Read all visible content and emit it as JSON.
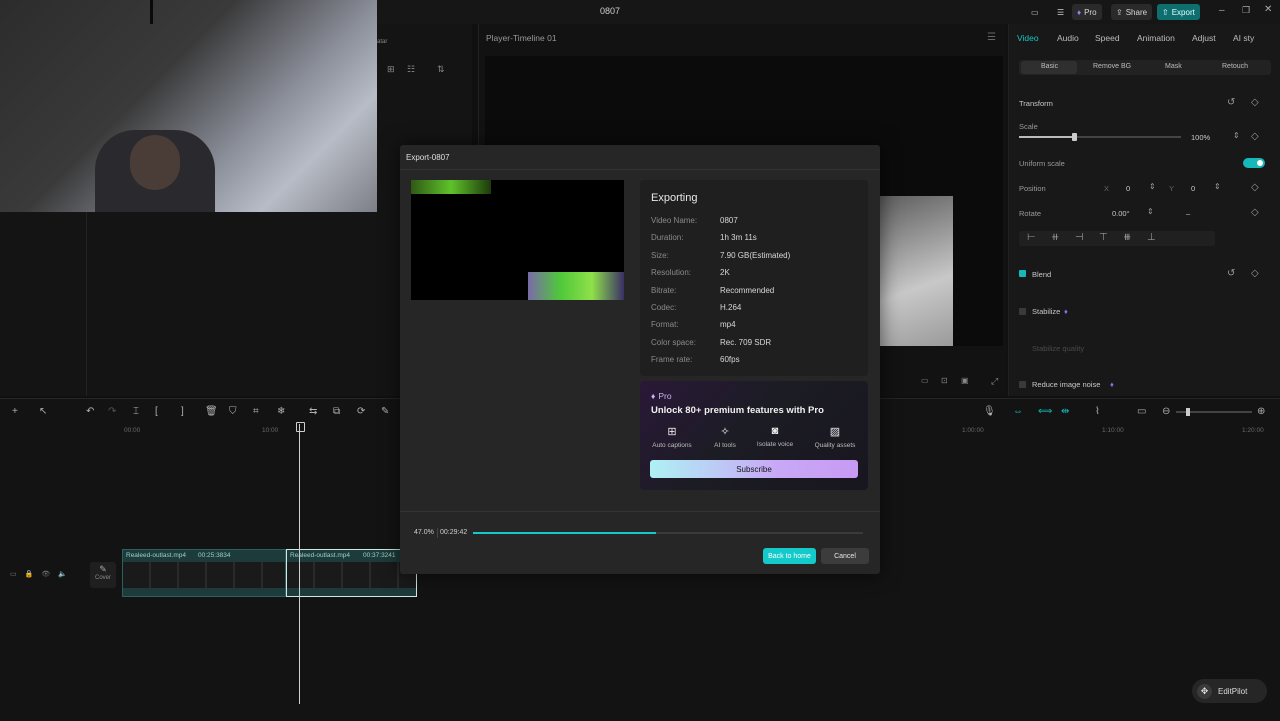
{
  "topbar": {
    "title": "0807",
    "pro_label": "Pro",
    "share_label": "Share",
    "export_label": "Export"
  },
  "player": {
    "title": "Player-Timeline 01"
  },
  "left_panel": {
    "avatar_label": "atar"
  },
  "props": {
    "tabs": [
      "Video",
      "Audio",
      "Speed",
      "Animation",
      "Adjust",
      "AI sty"
    ],
    "subtabs": [
      "Basic",
      "Remove BG",
      "Mask",
      "Retouch"
    ],
    "transform_label": "Transform",
    "scale_label": "Scale",
    "scale_value": "100%",
    "scale_level": 0.34,
    "uniform_scale_label": "Uniform scale",
    "position_label": "Position",
    "pos_x_label": "X",
    "pos_x": "0",
    "pos_y_label": "Y",
    "pos_y": "0",
    "rotate_label": "Rotate",
    "rotate_value": "0.00°",
    "rotate_dash": "–",
    "blend_label": "Blend",
    "stabilize_label": "Stabilize",
    "stabilize_sub": "Stabilize quality",
    "noise_label": "Reduce image noise"
  },
  "modal": {
    "title": "Export-0807",
    "heading": "Exporting",
    "rows": [
      {
        "k": "Video Name:",
        "v": "0807"
      },
      {
        "k": "Duration:",
        "v": "1h 3m 11s"
      },
      {
        "k": "Size:",
        "v": "7.90 GB(Estimated)"
      },
      {
        "k": "Resolution:",
        "v": "2K"
      },
      {
        "k": "Bitrate:",
        "v": "Recommended"
      },
      {
        "k": "Codec:",
        "v": "H.264"
      },
      {
        "k": "Format:",
        "v": "mp4"
      },
      {
        "k": "Color space:",
        "v": "Rec. 709 SDR"
      },
      {
        "k": "Frame rate:",
        "v": "60fps"
      }
    ],
    "pro_badge": "Pro",
    "pro_heading": "Unlock 80+ premium features with Pro",
    "features": [
      {
        "icon": "grid-icon",
        "label": "Auto captions"
      },
      {
        "icon": "magic-wand-icon",
        "label": "AI tools"
      },
      {
        "icon": "isolate-voice-icon",
        "label": "Isolate voice"
      },
      {
        "icon": "image-quality-icon",
        "label": "Quality assets"
      }
    ],
    "subscribe_label": "Subscribe",
    "progress_percent": "47.0%",
    "progress_fraction": 0.47,
    "progress_time": "00:29:42",
    "back_home_label": "Back to home",
    "cancel_label": "Cancel",
    "accent_color": "#14c9c9"
  },
  "timeline": {
    "ruler": [
      "00:00",
      "10:00",
      "1:00:00",
      "1:10:00",
      "1:20:00"
    ],
    "clips": [
      {
        "name": "Realeed-outlast.mp4",
        "duration": "00:25:3834"
      },
      {
        "name": "Realeed-outlast.mp4",
        "duration": "00:37:3241"
      }
    ],
    "cover_label": "Cover",
    "editpilot_label": "EditPilot"
  }
}
